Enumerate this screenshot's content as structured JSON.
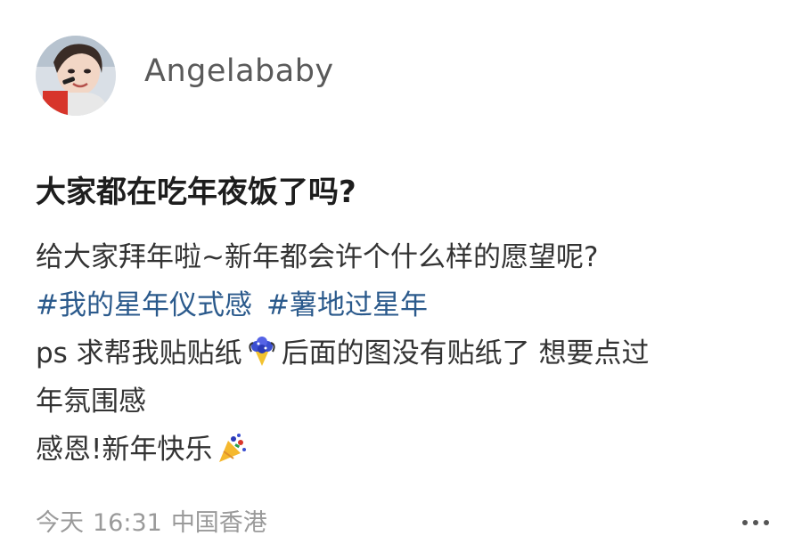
{
  "author": {
    "name": "Angelababy",
    "avatar_icon": "avatar-photo"
  },
  "post": {
    "title": "大家都在吃年夜饭了吗?",
    "line1": "给大家拜年啦~新年都会许个什么样的愿望呢?",
    "tags": [
      "#我的星年仪式感",
      "#薯地过星年"
    ],
    "line3_part1": "ps 求帮我贴贴纸",
    "line3_part2": "后面的图没有贴纸了 想要点过",
    "line4": "年氛围感",
    "line5": "感恩!新年快乐",
    "emoji_flower": "flower-bouquet-icon",
    "emoji_party": "party-popper-icon"
  },
  "meta": {
    "date": "今天",
    "time": "16:31",
    "location": "中国香港"
  },
  "colors": {
    "tag": "#2b5a8c",
    "text": "#333333",
    "meta": "#9a9a9a"
  }
}
